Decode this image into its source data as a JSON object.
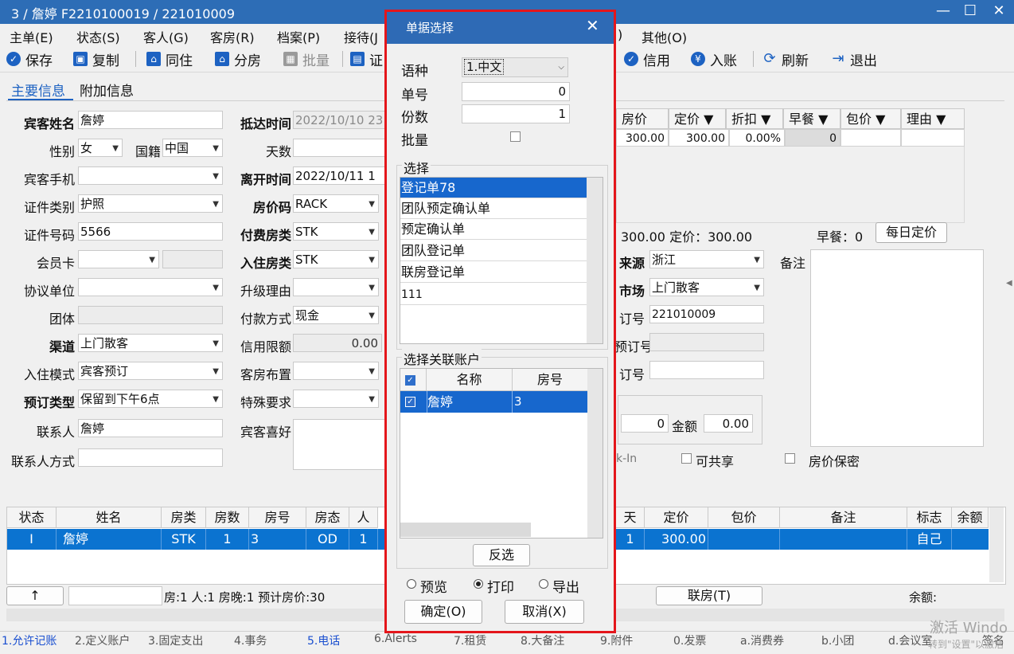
{
  "window": {
    "title": "3 / 詹婷 F2210100019 / 221010009"
  },
  "menu": [
    "主单(E)",
    "状态(S)",
    "客人(G)",
    "客房(R)",
    "档案(P)",
    "接待(J",
    "其他(O)",
    ")"
  ],
  "toolbar": {
    "save": "保存",
    "copy": "复制",
    "same_live": "同住",
    "split_room": "分房",
    "batch": "批量",
    "cert": "证",
    "credit": "信用",
    "checkin_acct": "入账",
    "refresh": "刷新",
    "exit": "退出"
  },
  "tabs": {
    "main": "主要信息",
    "extra": "附加信息"
  },
  "form": {
    "guest_name_label": "宾客姓名",
    "guest_name": "詹婷",
    "gender_label": "性别",
    "gender": "女",
    "nationality_label": "国籍",
    "nationality": "中国",
    "mobile_label": "宾客手机",
    "mobile": "",
    "id_type_label": "证件类别",
    "id_type": "护照",
    "id_no_label": "证件号码",
    "id_no": "5566",
    "member_label": "会员卡",
    "member": "",
    "agreement_label": "协议单位",
    "agreement": "",
    "group_label": "团体",
    "group": "",
    "channel_label": "渠道",
    "channel": "上门散客",
    "checkin_mode_label": "入住模式",
    "checkin_mode": "宾客预订",
    "booking_type_label": "预订类型",
    "booking_type": "保留到下午6点",
    "contact_label": "联系人",
    "contact": "詹婷",
    "contact_method_label": "联系人方式",
    "contact_method": "",
    "arrive_label": "抵达时间",
    "arrive": "2022/10/10 23",
    "days_label": "天数",
    "days": "",
    "leave_label": "离开时间",
    "leave": "2022/10/11 1",
    "rate_code_label": "房价码",
    "rate_code": "RACK",
    "pay_room_label": "付费房类",
    "pay_room": "STK",
    "live_room_label": "入住房类",
    "live_room": "STK",
    "upgrade_label": "升级理由",
    "upgrade": "",
    "pay_method_label": "付款方式",
    "pay_method": "现金",
    "credit_label": "信用限额",
    "credit": "0.00",
    "layout_label": "客房布置",
    "layout": "",
    "special_label": "特殊要求",
    "special": "",
    "pref_label": "宾客喜好",
    "pref": "",
    "source_label": "来源",
    "source": "浙江",
    "market_label": "市场",
    "market": "上门散客",
    "order_label": "订号",
    "order": "221010009",
    "preorder_label": "预订号",
    "preorder": "",
    "order2_label": "订号",
    "order2": "",
    "remark_label": "备注",
    "amount_label": "金额",
    "amount": "0.00",
    "qty": "0",
    "checkin_hint": "k-In",
    "shareable": "可共享",
    "price_secret": "房价保密",
    "price_info": "300.00  定价：300.00",
    "breakfast_info": "早餐：0",
    "daily_rate_btn": "每日定价"
  },
  "rate_grid": {
    "headers": [
      "房价",
      "定价 ▼",
      "折扣 ▼",
      "早餐 ▼",
      "包价 ▼",
      "理由 ▼"
    ],
    "row": [
      "300.00",
      "300.00",
      "0.00%",
      "0",
      "",
      ""
    ]
  },
  "bottom_grid": {
    "headers": [
      "状态",
      "姓名",
      "房类",
      "房数",
      "房号",
      "房态",
      "人",
      "天",
      "定价",
      "包价",
      "备注",
      "标志",
      "余额"
    ],
    "row": [
      "I",
      "詹婷",
      "STK",
      "1",
      "3",
      "OD",
      "1",
      "1",
      "300.00",
      "",
      "",
      "自己",
      ""
    ]
  },
  "footer": {
    "up_btn": "↑",
    "summary": "房:1  人:1  房晚:1  预计房价:30",
    "link_room_btn": "联房(T)",
    "balance_label": "余额:"
  },
  "statusbar": [
    "1.允许记账",
    "2.定义账户",
    "3.固定支出",
    "4.事务",
    "5.电话",
    "6.Alerts",
    "7.租赁",
    "8.大备注",
    "9.附件",
    "0.发票",
    "a.消费券",
    "b.小团",
    "d.会议室",
    "签名"
  ],
  "watermark": {
    "line1": "激活 Windo",
    "line2": "转到\"设置\"以激活"
  },
  "dialog": {
    "title": "单据选择",
    "lang_label": "语种",
    "lang": "1.中文",
    "no_label": "单号",
    "no": "0",
    "copies_label": "份数",
    "copies": "1",
    "batch_label": "批量",
    "select_label": "选择",
    "items": [
      "登记单78",
      "团队预定确认单",
      "预定确认单",
      "团队登记单",
      "联房登记单",
      "111"
    ],
    "link_label": "选择关联账户",
    "col_name": "名称",
    "col_room": "房号",
    "acct_name": "詹婷",
    "acct_room": "3",
    "invert_btn": "反选",
    "preview": "预览",
    "print": "打印",
    "export": "导出",
    "ok_btn": "确定(O)",
    "cancel_btn": "取消(X)"
  }
}
